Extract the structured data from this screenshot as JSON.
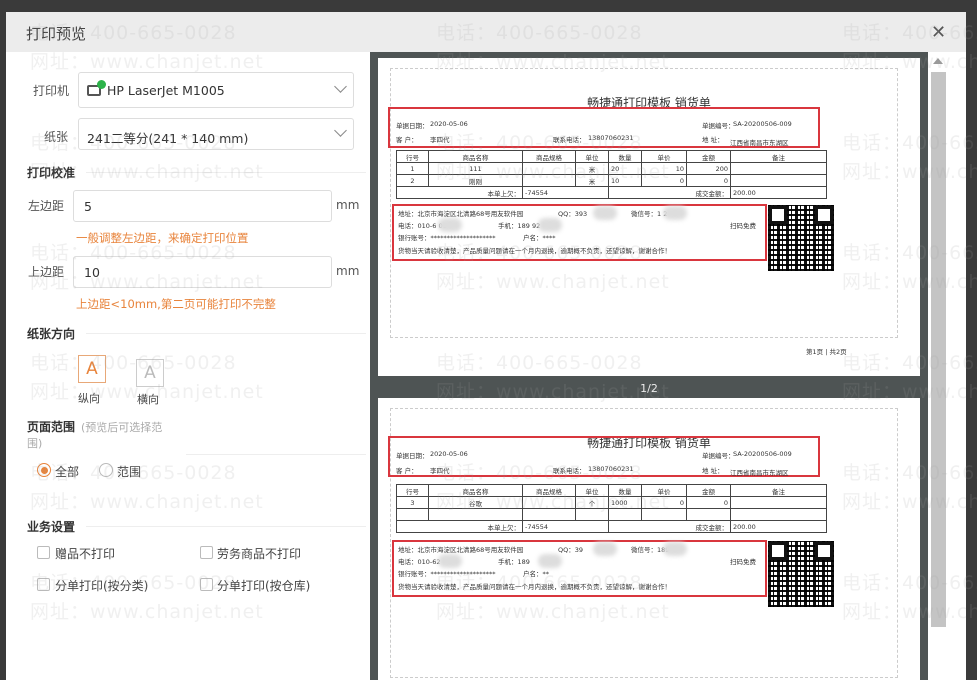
{
  "dialog": {
    "title": "打印预览",
    "close_icon": "close-icon"
  },
  "watermark": {
    "line1": "电话：400-665-0028",
    "line2": "网址：www.chanjet.net"
  },
  "settings": {
    "printer_label": "打印机",
    "printer_value": "HP LaserJet M1005",
    "printer_icon": "printer-check-icon",
    "paper_label": "纸张",
    "paper_value": "241二等分(241  * 140  mm)",
    "calibration_title": "打印校准",
    "left_margin_label": "左边距",
    "left_margin_value": "5",
    "left_margin_unit": "mm",
    "left_margin_hint": "一般调整左边距，来确定打印位置",
    "top_margin_label": "上边距",
    "top_margin_value": "10",
    "top_margin_unit": "mm",
    "top_margin_hint": "上边距<10mm,第二页可能打印不完整",
    "orientation_title": "纸张方向",
    "portrait_label": "纵向",
    "landscape_label": "横向",
    "orientation_glyph": "A",
    "orientation_selected": "纵向",
    "range_title": "页面范围",
    "range_note": "(预览后可选择范",
    "range_note2": "围)",
    "range_all": "全部",
    "range_custom": "范围",
    "range_selected": "全部",
    "business_title": "业务设置",
    "checkboxes": [
      {
        "label": "赠品不打印",
        "checked": false
      },
      {
        "label": "劳务商品不打印",
        "checked": false
      },
      {
        "label": "分单打印(按分类)",
        "checked": false
      },
      {
        "label": "分单打印(按仓库)",
        "checked": false
      }
    ]
  },
  "accent_color": "#e8843c",
  "preview": {
    "page_indicator": "1/2",
    "pages": [
      {
        "title": "畅捷通打印模板 销货单",
        "date_label": "单据日期：",
        "date": "2020-05-06",
        "no_label": "单据编号：",
        "no": "SA-20200506-009",
        "customer_label": "客    户：",
        "customer": "李四代",
        "phone_label": "联系电话：",
        "phone": "13807060231",
        "addr_label": "地  址：",
        "addr": "江西省南昌市东湖区",
        "headers": [
          "行号",
          "商品名称",
          "商品规格",
          "单位",
          "数量",
          "单价",
          "金额",
          "备注"
        ],
        "rows": [
          [
            "1",
            "111",
            "",
            "米",
            "20",
            "10",
            "200",
            ""
          ],
          [
            "2",
            "刚刚",
            "",
            "米",
            "10",
            "0",
            "0",
            ""
          ]
        ],
        "debt_label": "本单上欠：",
        "debt": "-74554",
        "total_label": "成交金额：",
        "total": "200.00",
        "f_addr": "地址：北京市海淀区北清路68号用友软件园",
        "f_qq": "QQ：393",
        "f_wx": "微信号：1          2",
        "f_tel": "电话：010-6      01",
        "f_mobile": "手机：189        92",
        "f_bank": "银行账号：********************",
        "f_acct": "户名：****",
        "f_scan": "扫码免费",
        "f_note": "货物当天请验收清楚，产品质量问题请在一个月内退换，逾期概不负责，还望谅解，谢谢合作！",
        "footer": "第1页 | 共2页"
      },
      {
        "title": "畅捷通打印模板 销货单",
        "date_label": "单据日期：",
        "date": "2020-05-06",
        "no_label": "单据编号：",
        "no": "SA-20200506-009",
        "customer_label": "客    户：",
        "customer": "李四代",
        "phone_label": "联系电话：",
        "phone": "13807060231",
        "addr_label": "地  址：",
        "addr": "江西省南昌市东湖区",
        "headers": [
          "行号",
          "商品名称",
          "商品规格",
          "单位",
          "数量",
          "单价",
          "金额",
          "备注"
        ],
        "rows": [
          [
            "3",
            "谷歌",
            "",
            "个",
            "1000",
            "0",
            "0",
            ""
          ],
          [
            "",
            "",
            "",
            "",
            "",
            "",
            "",
            ""
          ]
        ],
        "debt_label": "本单上欠：",
        "debt": "-74554",
        "total_label": "成交金额：",
        "total": "200.00",
        "f_addr": "地址：北京市海淀区北清路68号用友软件园",
        "f_qq": "QQ：39",
        "f_wx": "微信号：189",
        "f_tel": "电话：010-62",
        "f_mobile": "手机：189",
        "f_bank": "银行账号：********************",
        "f_acct": "户名：**",
        "f_scan": "扫码免费",
        "f_note": "货物当天请验收清楚，产品质量问题请在一个月内退换，逾期概不负责，还望谅解，谢谢合作！",
        "footer": ""
      }
    ]
  }
}
